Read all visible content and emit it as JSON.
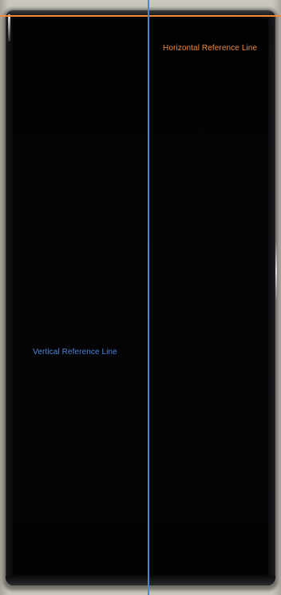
{
  "labels": {
    "horizontal_reference": "Horizontal Reference Line",
    "vertical_reference": "Vertical Reference Line"
  },
  "colors": {
    "horizontal_line": "#ef8a38",
    "vertical_line": "#4c84d9",
    "device_body": "#030304",
    "background": "#c9c7be"
  }
}
